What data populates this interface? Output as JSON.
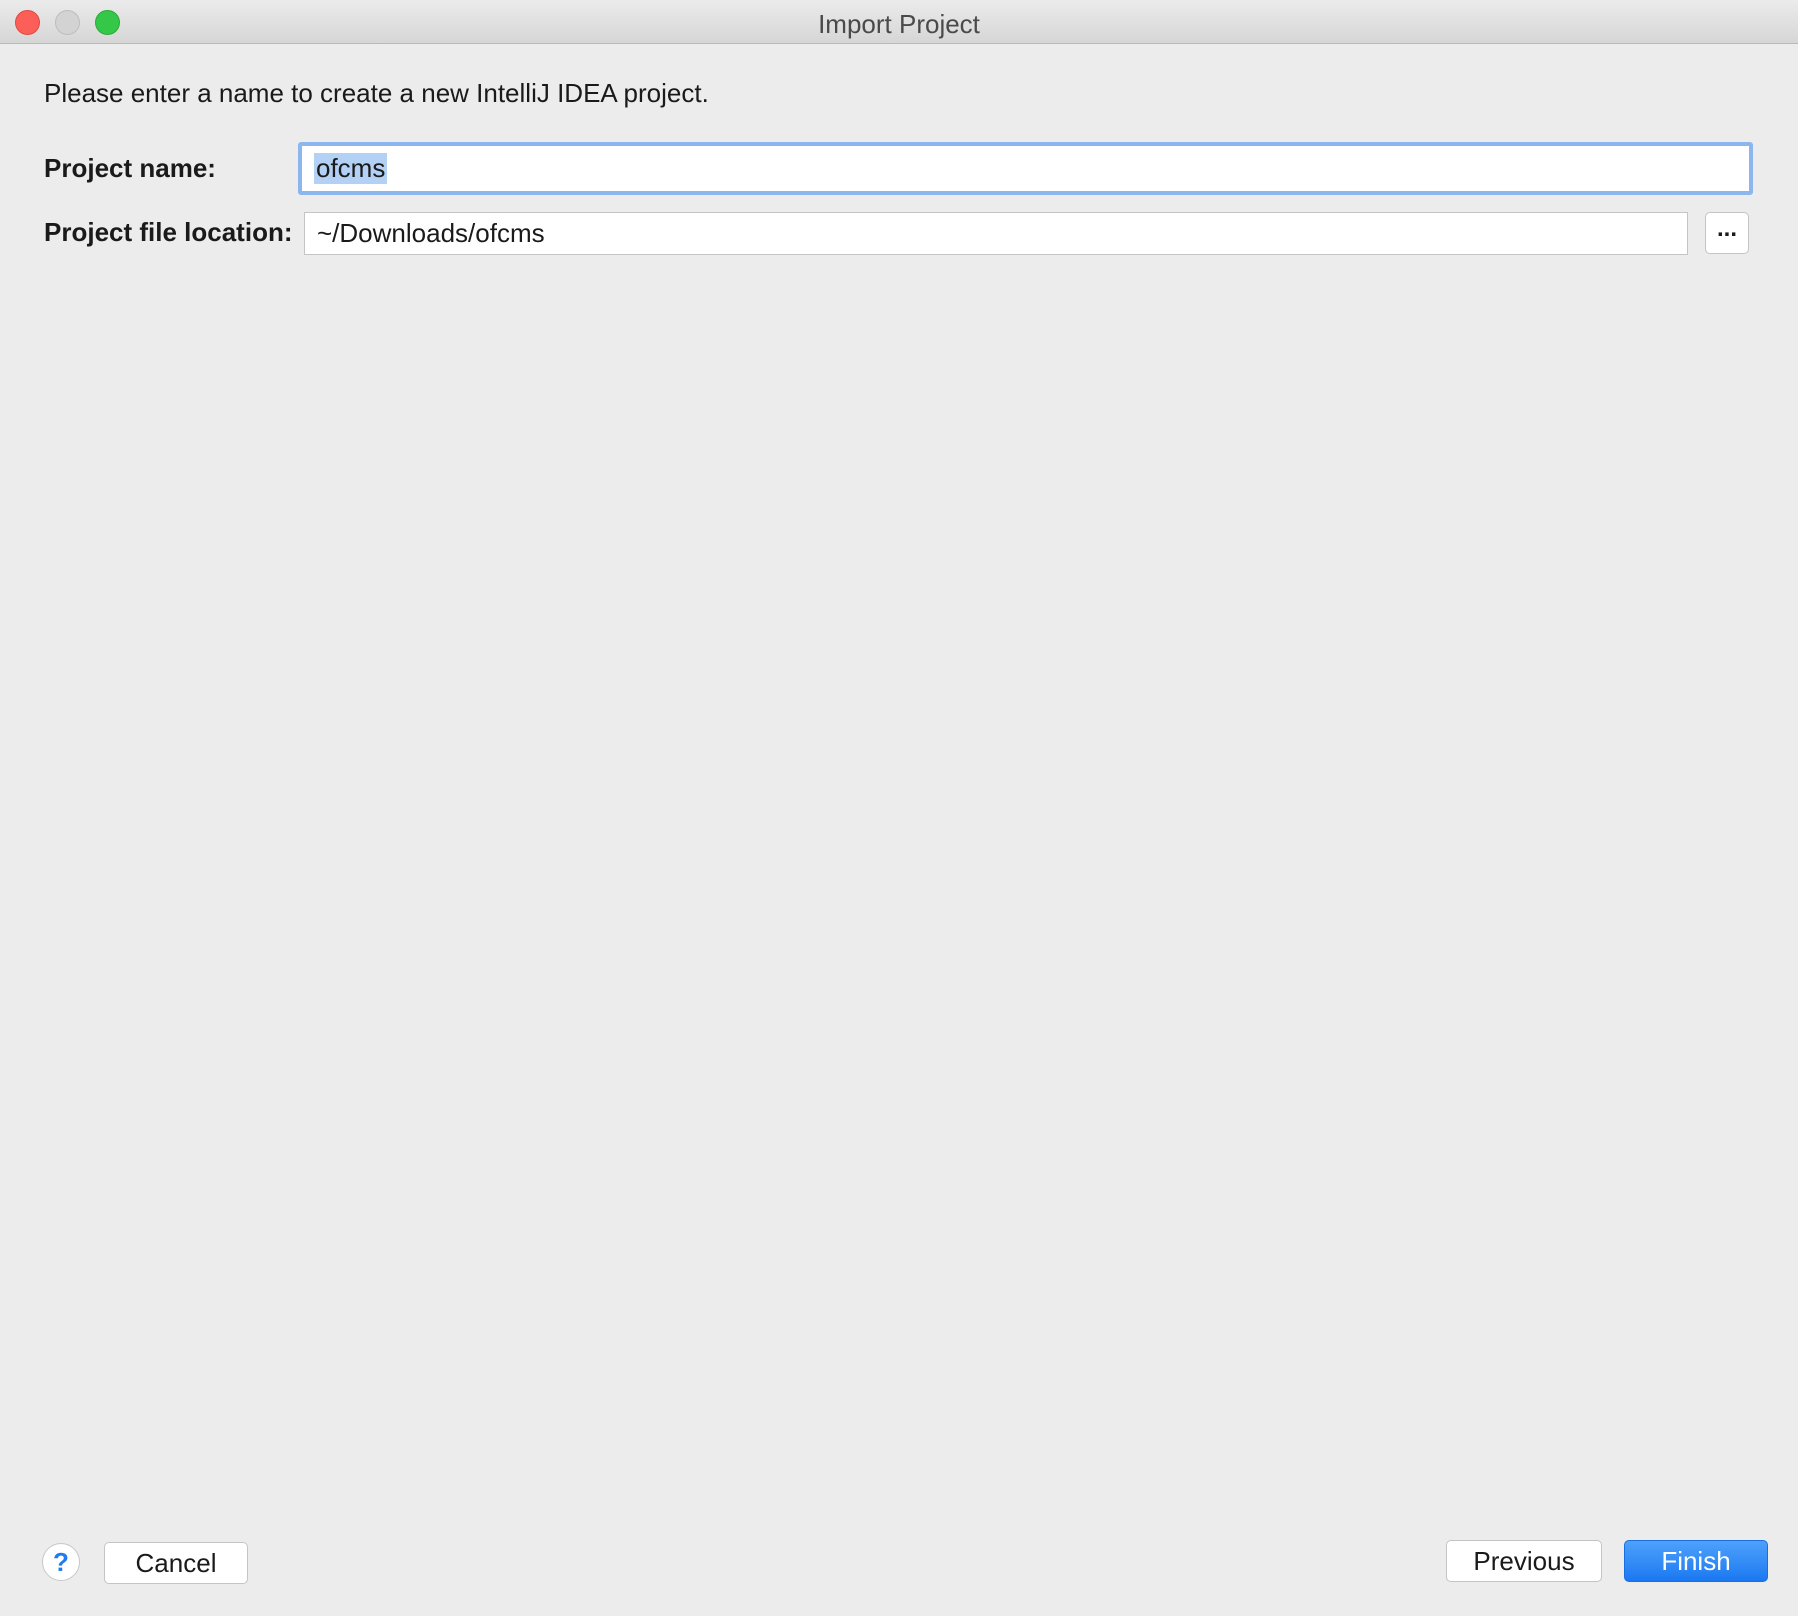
{
  "window": {
    "title": "Import Project"
  },
  "form": {
    "intro": "Please enter a name to create a new IntelliJ IDEA project.",
    "project_name_label": "Project name:",
    "project_name_value": "ofcms",
    "project_location_label": "Project file location:",
    "project_location_value": "~/Downloads/ofcms",
    "browse_label": "..."
  },
  "footer": {
    "help_label": "?",
    "cancel_label": "Cancel",
    "previous_label": "Previous",
    "finish_label": "Finish"
  },
  "colors": {
    "accent": "#1e7cf0",
    "focus_ring": "#8db6ee",
    "selection": "#b3d1f5",
    "background": "#ececec"
  }
}
